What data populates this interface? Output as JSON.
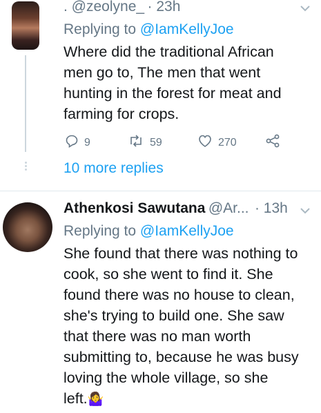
{
  "tweet1": {
    "handle": ". @zeolyne_",
    "time": "· 23h",
    "replying_label": "Replying to",
    "replying_handle": "@IamKellyJoe",
    "lines": [
      "Where did the traditional African",
      "men go to, The men that went",
      "hunting in the forest for meat and",
      "farming for crops."
    ],
    "replies": "9",
    "retweets": "59",
    "likes": "270",
    "icons": [
      "reply-icon",
      "retweet-icon",
      "like-icon",
      "share-icon",
      "chevron-down-icon"
    ]
  },
  "more_replies": "10 more replies",
  "tweet2": {
    "name": "Athenkosi Sawutana",
    "handle": "@Ar...",
    "time": "· 13h",
    "replying_label": "Replying to",
    "replying_handle": "@IamKellyJoe",
    "lines": [
      "She found that there was nothing to",
      "cook, so she went to find it. She",
      "found there was no house to clean,",
      "she's trying to build one. She saw",
      "that there was no man worth",
      "submitting to, because he was busy",
      "loving the whole village, so she",
      "left."
    ],
    "emoji": "🤷‍♀️"
  },
  "colors": {
    "accent": "#1da1f2",
    "secondary": "#657786",
    "text": "#14171a"
  }
}
